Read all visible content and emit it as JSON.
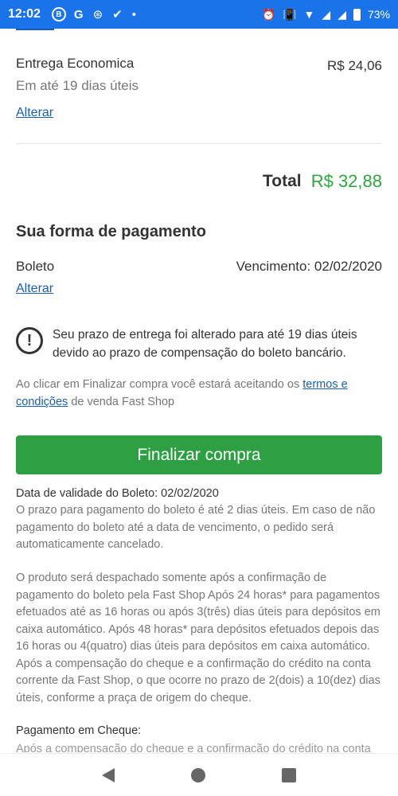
{
  "status_bar": {
    "time": "12:02",
    "icons_left": [
      "B",
      "G",
      "⊛",
      "✔",
      "•"
    ],
    "battery": "73%"
  },
  "shipping": {
    "name": "Entrega Economica",
    "price": "R$ 24,06",
    "days": "Em até 19 dias úteis",
    "change_link": "Alterar"
  },
  "total": {
    "label": "Total",
    "value": "R$ 32,88"
  },
  "payment": {
    "title": "Sua forma de pagamento",
    "method": "Boleto",
    "due": "Vencimento: 02/02/2020",
    "change_link": "Alterar"
  },
  "warning": {
    "text": "Seu prazo de entrega foi alterado para até 19 dias úteis devido ao prazo de compensação do boleto bancário."
  },
  "terms": {
    "prefix": "Ao clicar em Finalizar compra você estará aceitando os ",
    "link": "termos e condições",
    "suffix": " de venda Fast Shop"
  },
  "finalize_button": "Finalizar compra",
  "boleto_info": {
    "validity": "Data de validade do Boleto: 02/02/2020",
    "para1": "O prazo para pagamento do boleto é até 2 dias úteis. Em caso de não pagamento do boleto até a data de vencimento, o pedido será automaticamente cancelado.",
    "para2": "O produto será despachado somente após a confirmação de pagamento do boleto pela Fast Shop Após 24 horas* para pagamentos efetuados até as 16 horas ou após 3(três) dias úteis para depósitos em caixa automático. Após 48 horas* para depósitos efetuados depois das 16 horas ou 4(quatro) dias úteis para depósitos em caixa automático. Após a compensação do cheque e a confirmação do crédito na conta corrente da Fast Shop, o que ocorre no prazo de 2(dois) a 10(dez) dias úteis, conforme a praça de origem do cheque.",
    "cheque_title": "Pagamento em Cheque:",
    "cheque_text": "Após a compensação do cheque e a confirmação do crédito na conta"
  },
  "colors": {
    "status_bar": "#1a73e8",
    "link": "#1a5fb4",
    "total_value": "#2fa640",
    "button": "#2ea043"
  }
}
